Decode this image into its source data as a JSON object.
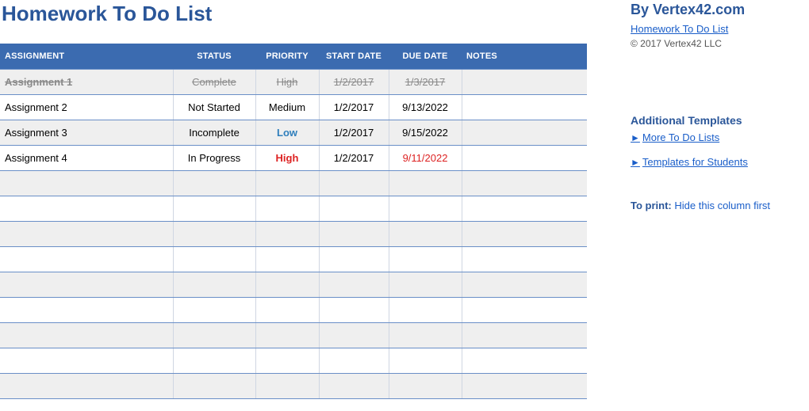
{
  "header": {
    "title": "Homework To Do List"
  },
  "table": {
    "columns": {
      "assignment": "Assignment",
      "status": "Status",
      "priority": "Priority",
      "start_date": "Start Date",
      "due_date": "Due Date",
      "notes": "Notes"
    },
    "rows": [
      {
        "assignment": "Assignment 1",
        "status": "Complete",
        "priority": "High",
        "start": "1/2/2017",
        "due": "1/3/2017",
        "notes": "",
        "struck": true,
        "stripe": true
      },
      {
        "assignment": "Assignment 2",
        "status": "Not Started",
        "priority": "Medium",
        "start": "1/2/2017",
        "due": "9/13/2022",
        "notes": "",
        "struck": false,
        "stripe": false
      },
      {
        "assignment": "Assignment 3",
        "status": "Incomplete",
        "priority": "Low",
        "start": "1/2/2017",
        "due": "9/15/2022",
        "notes": "",
        "struck": false,
        "stripe": true,
        "prio_style": "low"
      },
      {
        "assignment": "Assignment 4",
        "status": "In Progress",
        "priority": "High",
        "start": "1/2/2017",
        "due": "9/11/2022",
        "notes": "",
        "struck": false,
        "stripe": false,
        "prio_style": "high-red",
        "due_style": "red"
      }
    ],
    "empty_rows": 9
  },
  "sidebar": {
    "by": "By Vertex42.com",
    "title_link": "Homework To Do List",
    "copyright": "© 2017 Vertex42 LLC",
    "additional_heading": "Additional Templates",
    "link1": "More To Do Lists",
    "link2": "Templates for Students",
    "print_label": "To print:",
    "print_text": "Hide this column first"
  }
}
